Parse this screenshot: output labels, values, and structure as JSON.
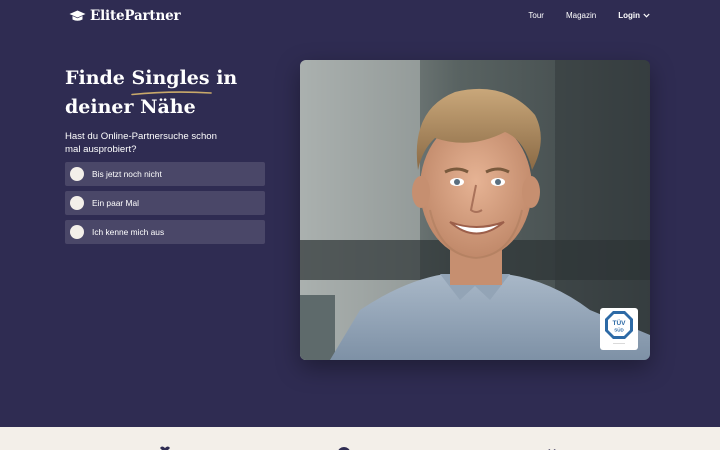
{
  "brand": {
    "name": "ElitePartner"
  },
  "nav": {
    "tour": "Tour",
    "magazin": "Magazin",
    "login": "Login"
  },
  "hero": {
    "title_line1_a": "Finde",
    "title_line1_highlight": "Singles",
    "title_line1_b": "in",
    "title_line2": "deiner Nähe",
    "question": "Hast du Online-Partnersuche schon mal ausprobiert?",
    "options": [
      {
        "label": "Bis jetzt noch nicht"
      },
      {
        "label": "Ein paar Mal"
      },
      {
        "label": "Ich kenne mich aus"
      }
    ]
  },
  "badge": {
    "top": "TÜV",
    "bottom": "SÜD"
  },
  "colors": {
    "background": "#2f2c52",
    "option_background": "#4a4768",
    "radio": "#f3efe9",
    "underline_accent": "#c9a96a",
    "footer_band": "#f3efe9",
    "tuv_blue": "#2d6aa6"
  }
}
